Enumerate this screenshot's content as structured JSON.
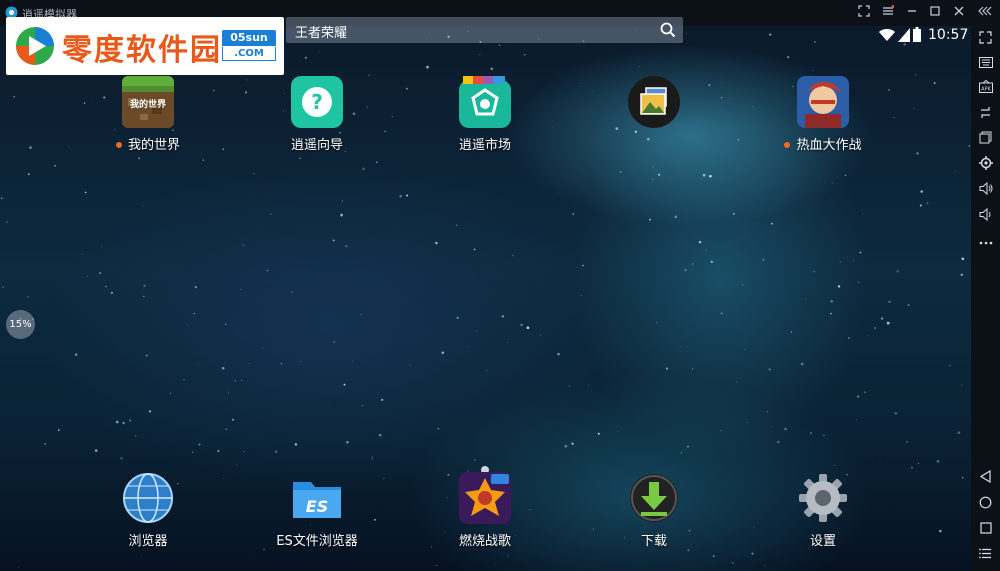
{
  "titlebar": {
    "app_title": "逍遥模拟器"
  },
  "watermark": {
    "text": "零度软件园",
    "badge_top": "05sun",
    "badge_bottom": ".COM"
  },
  "search": {
    "value": "王者荣耀"
  },
  "status_bar": {
    "time": "10:57"
  },
  "desktop": {
    "top_apps": [
      {
        "label": "我的世界",
        "icon": "minecraft-icon",
        "new_dot": true
      },
      {
        "label": "逍遥向导",
        "icon": "help-guide-icon",
        "new_dot": false
      },
      {
        "label": "逍遥市场",
        "icon": "market-icon",
        "new_dot": false
      },
      {
        "label": "",
        "icon": "gallery-icon",
        "new_dot": false
      },
      {
        "label": "热血大作战",
        "icon": "game-hero-icon",
        "new_dot": true
      }
    ],
    "dock_apps": [
      {
        "label": "浏览器",
        "icon": "browser-globe-icon"
      },
      {
        "label": "ES文件浏览器",
        "icon": "es-file-folder-icon"
      },
      {
        "label": "燃烧战歌",
        "icon": "game-burning-icon"
      },
      {
        "label": "下载",
        "icon": "download-icon"
      },
      {
        "label": "设置",
        "icon": "settings-gear-icon"
      }
    ]
  },
  "cpu_indicator": {
    "value": "15%"
  },
  "sidebar": {
    "tools": [
      "fullscreen-icon",
      "keyboard-icon",
      "apk-install-icon",
      "rotate-icon",
      "multi-window-icon",
      "settings-icon",
      "volume-up-icon",
      "volume-down-icon",
      "more-icon"
    ],
    "nav": [
      "back-icon",
      "home-icon",
      "recents-icon",
      "menu-icon"
    ]
  },
  "colors": {
    "accent_orange": "#f26b21",
    "titlebar_bg": "#0c1118",
    "watermark_orange": "#e85a1a",
    "watermark_blue": "#1b7fd6"
  }
}
